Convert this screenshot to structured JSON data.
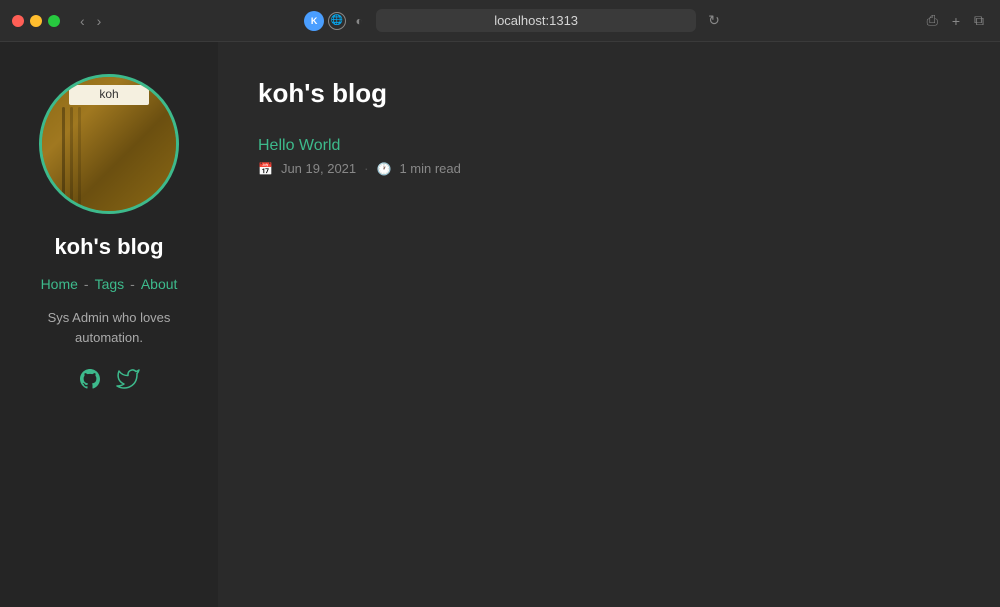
{
  "browser": {
    "url": "localhost:1313",
    "favicon_label": "K",
    "back_btn": "‹",
    "forward_btn": "›",
    "reload_icon": "↻",
    "share_icon": "⎙",
    "new_tab_icon": "+",
    "tabs_icon": "⧉"
  },
  "sidebar": {
    "blog_title": "koh's blog",
    "avatar_alt": "koh avatar",
    "nav": {
      "home": "Home",
      "sep1": "-",
      "tags": "Tags",
      "sep2": "-",
      "about": "About"
    },
    "bio": "Sys Admin who loves automation.",
    "github_icon": "⌥",
    "twitter_icon": "🐦"
  },
  "main": {
    "page_title": "koh's blog",
    "posts": [
      {
        "title": "Hello World",
        "date": "Jun 19, 2021",
        "read_time": "1 min read",
        "calendar_icon": "📅",
        "clock_icon": "🕐"
      }
    ]
  },
  "colors": {
    "accent": "#3dba8c",
    "bg_sidebar": "#252525",
    "bg_main": "#2a2a2a",
    "bg_browser": "#2d2d2d",
    "text_primary": "#ffffff",
    "text_secondary": "#aaaaaa",
    "text_meta": "#888888"
  }
}
